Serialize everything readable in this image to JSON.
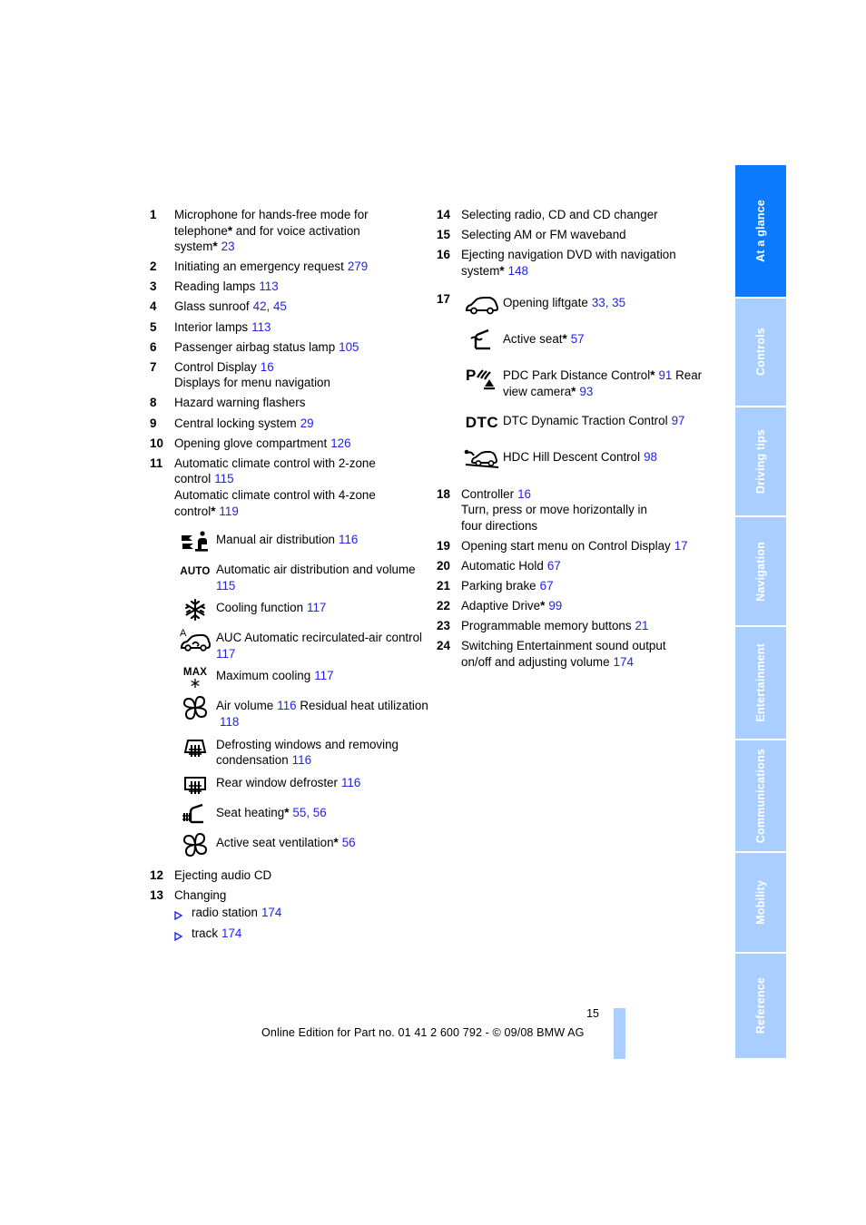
{
  "document": {
    "page_number": "15",
    "footer": "Online Edition for Part no. 01 41 2 600 792 - © 09/08 BMW AG"
  },
  "colors": {
    "active_tab": "#0b7afd",
    "inactive_tab": "#a9ceff",
    "page_reference": "#2222ee"
  },
  "sidebar": {
    "tabs": [
      {
        "label": "At a glance",
        "active": true
      },
      {
        "label": "Controls",
        "active": false
      },
      {
        "label": "Driving tips",
        "active": false
      },
      {
        "label": "Navigation",
        "active": false
      },
      {
        "label": "Entertainment",
        "active": false
      },
      {
        "label": "Communications",
        "active": false
      },
      {
        "label": "Mobility",
        "active": false
      },
      {
        "label": "Reference",
        "active": false
      }
    ]
  },
  "left_column": {
    "item1": {
      "num": "1",
      "line1": "Microphone for hands-free mode for",
      "line2_a": "telephone",
      "line2_b": " and for voice activation",
      "line3_a": "system",
      "line3_page": "23"
    },
    "item2": {
      "num": "2",
      "text": "Initiating an emergency request",
      "page": "279"
    },
    "item3": {
      "num": "3",
      "text": "Reading lamps",
      "page": "113"
    },
    "item4": {
      "num": "4",
      "text": "Glass sunroof",
      "page": "42, 45"
    },
    "item5": {
      "num": "5",
      "text": "Interior lamps",
      "page": "113"
    },
    "item6": {
      "num": "6",
      "text": "Passenger airbag status lamp",
      "page": "105"
    },
    "item7": {
      "num": "7",
      "text": "Control Display",
      "page": "16",
      "sub": "Displays for menu navigation"
    },
    "item8": {
      "num": "8",
      "text": "Hazard warning flashers"
    },
    "item9": {
      "num": "9",
      "text": "Central locking system",
      "page": "29"
    },
    "item10": {
      "num": "10",
      "text": "Opening glove compartment",
      "page": "126"
    },
    "item11": {
      "num": "11",
      "line1": "Automatic climate control with 2-zone",
      "line2": "control",
      "page1": "115",
      "line3": "Automatic climate control with 4-zone",
      "line4": "control",
      "page2": "119"
    },
    "climate_icons": [
      {
        "icon": "manual-air-distribution-icon",
        "label": "Manual air distribution",
        "page": "116"
      },
      {
        "icon": "auto-text-icon",
        "icon_text": "AUTO",
        "label_line1": "Automatic air distribution and",
        "label_line2": "volume",
        "page": "115"
      },
      {
        "icon": "snowflake-icon",
        "label": "Cooling function",
        "page": "117"
      },
      {
        "icon": "auc-recirculated-air-icon",
        "label_line1": "AUC Automatic recirculated-air",
        "label_line2": "control",
        "page": "117"
      },
      {
        "icon": "max-cooling-icon",
        "icon_text": "MAX",
        "label": "Maximum cooling",
        "page": "117"
      },
      {
        "icon": "fan-icon",
        "label_line1": "Air volume",
        "page1": "116",
        "label_line2": "Residual heat utilization",
        "page2": "118"
      },
      {
        "icon": "windshield-defrost-icon",
        "label_line1": "Defrosting windows and",
        "label_line2": "removing condensation",
        "page": "116"
      },
      {
        "icon": "rear-window-defroster-icon",
        "label": "Rear window defroster",
        "page": "116"
      },
      {
        "icon": "seat-heating-icon",
        "label": "Seat heating",
        "starred": true,
        "page": "55, 56"
      },
      {
        "icon": "active-seat-ventilation-icon",
        "label": "Active seat ventilation",
        "starred": true,
        "page": "56"
      }
    ],
    "item12": {
      "num": "12",
      "text": "Ejecting audio CD"
    },
    "item13": {
      "num": "13",
      "text": "Changing",
      "bullets": [
        {
          "label": "radio station",
          "page": "174"
        },
        {
          "label": "track",
          "page": "174"
        }
      ]
    }
  },
  "right_column": {
    "item14": {
      "num": "14",
      "text": "Selecting radio, CD and CD changer"
    },
    "item15": {
      "num": "15",
      "text": "Selecting AM or FM waveband"
    },
    "item16": {
      "num": "16",
      "line1": "Ejecting navigation DVD with navigation",
      "line2": "system",
      "page": "148"
    },
    "item17": {
      "num": "17",
      "icons": [
        {
          "icon": "liftgate-car-icon",
          "label": "Opening liftgate",
          "page": "33, 35"
        },
        {
          "icon": "active-seat-icon",
          "label": "Active seat",
          "starred": true,
          "page": "57"
        },
        {
          "icon": "pdc-park-distance-icon",
          "label_line1": "PDC Park Distance Control",
          "starred1": true,
          "page1": "91",
          "label_line2": "Rear view camera",
          "starred2": true,
          "page2": "93"
        },
        {
          "icon": "dtc-text-icon",
          "icon_text": "DTC",
          "label": "DTC Dynamic Traction Control",
          "page": "97"
        },
        {
          "icon": "hdc-hill-descent-icon",
          "label": "HDC Hill Descent Control",
          "page": "98"
        }
      ]
    },
    "item18": {
      "num": "18",
      "text": "Controller",
      "page": "16",
      "sub_line1": "Turn, press or move horizontally in",
      "sub_line2": "four directions"
    },
    "item19": {
      "num": "19",
      "text": "Opening start menu on Control Display",
      "page": "17"
    },
    "item20": {
      "num": "20",
      "text": "Automatic Hold",
      "page": "67"
    },
    "item21": {
      "num": "21",
      "text": "Parking brake",
      "page": "67"
    },
    "item22": {
      "num": "22",
      "text": "Adaptive Drive",
      "starred": true,
      "page": "99"
    },
    "item23": {
      "num": "23",
      "text": "Programmable memory buttons",
      "page": "21"
    },
    "item24": {
      "num": "24",
      "line1": "Switching Entertainment sound output",
      "line2": "on/off and adjusting volume",
      "page": "174"
    }
  }
}
